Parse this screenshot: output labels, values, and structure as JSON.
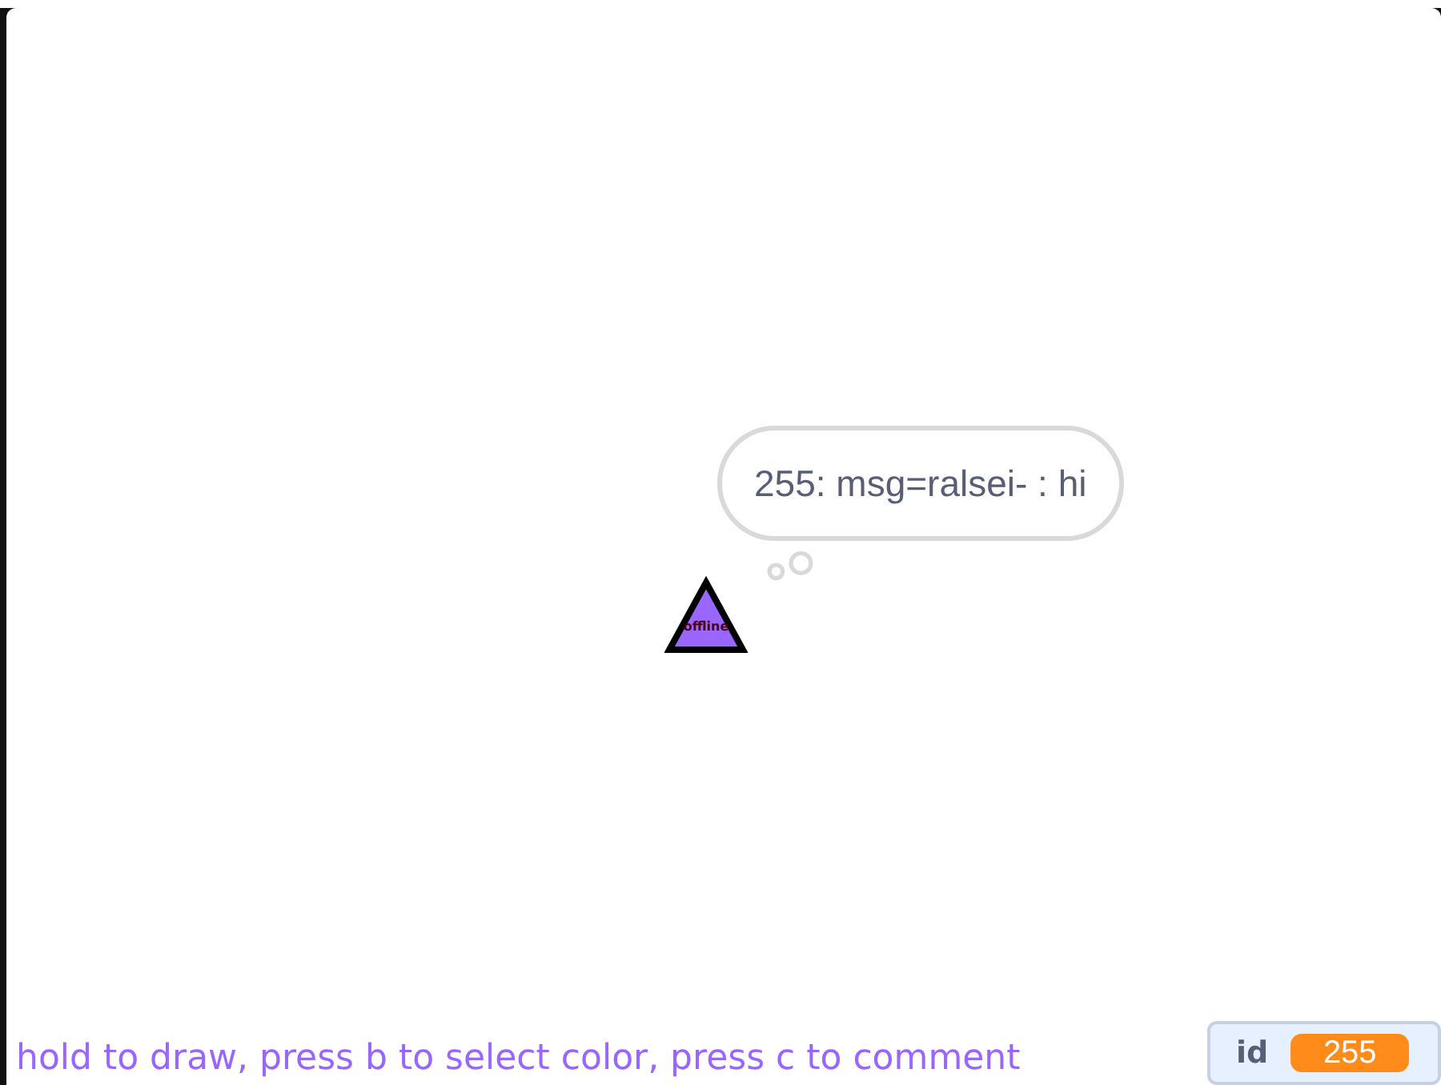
{
  "sprite": {
    "label": "offline",
    "bubble": {
      "kind": "think",
      "text": "255: msg=ralsei- : hi"
    }
  },
  "hint": "hold to draw, press b to select color, press c to comment",
  "monitor": {
    "label": "id",
    "value": "255"
  }
}
